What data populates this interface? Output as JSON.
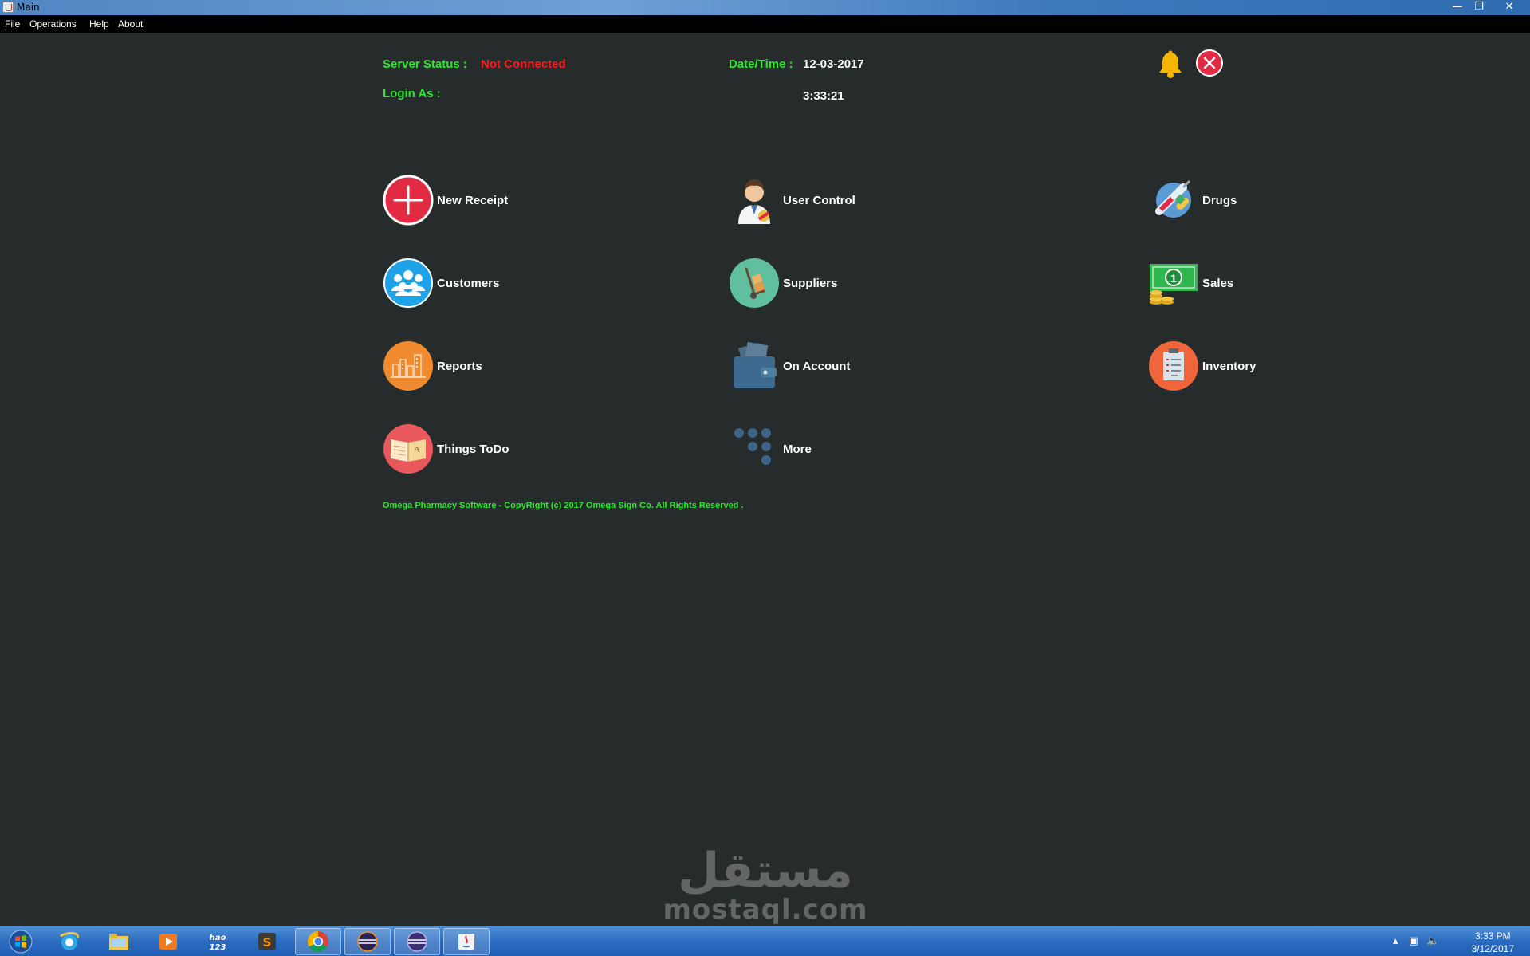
{
  "window": {
    "title": "Main",
    "controls": [
      "minimize-icon",
      "restore-icon",
      "close-icon"
    ]
  },
  "menu": [
    {
      "label": "File"
    },
    {
      "label": "Operations"
    },
    {
      "label": "Help"
    },
    {
      "label": "About"
    }
  ],
  "status": {
    "server_label": "Server Status :",
    "server_value": "Not Connected",
    "login_label": "Login As :",
    "login_value": "",
    "datetime_label": "Date/Time :",
    "date_value": "12-03-2017",
    "time_value": "3:33:21"
  },
  "tiles": [
    {
      "label": "New Receipt",
      "icon": "add-icon"
    },
    {
      "label": "User Control",
      "icon": "doctor-icon"
    },
    {
      "label": "Drugs",
      "icon": "syringe-pill-icon"
    },
    {
      "label": "Customers",
      "icon": "group-icon"
    },
    {
      "label": "Suppliers",
      "icon": "hand-truck-icon"
    },
    {
      "label": "Sales",
      "icon": "money-coins-icon"
    },
    {
      "label": "Reports",
      "icon": "city-chart-icon"
    },
    {
      "label": "On Account",
      "icon": "wallet-icon"
    },
    {
      "label": "Inventory",
      "icon": "clipboard-icon"
    },
    {
      "label": "Things ToDo",
      "icon": "book-icon"
    },
    {
      "label": "More",
      "icon": "dots-icon"
    }
  ],
  "footer": "Omega Pharmacy Software  - CopyRight (c) 2017 Omega Sign Co.  All Rights Reserved .",
  "watermark": {
    "arabic": "مستقل",
    "latin": "mostaql.com"
  },
  "colors": {
    "background": "#262b2c",
    "status_green": "#2fe62f",
    "status_red": "#ff1a1a"
  },
  "taskbar": {
    "apps": [
      "start-orb-icon",
      "internet-explorer-icon",
      "file-explorer-icon",
      "media-player-icon",
      "hao123-icon",
      "sublime-text-icon",
      "chrome-icon",
      "eclipse-icon",
      "eclipse-icon-2",
      "java-icon"
    ],
    "hao_label": "hao 123",
    "clock_time": "3:33 PM",
    "clock_date": "3/12/2017"
  }
}
